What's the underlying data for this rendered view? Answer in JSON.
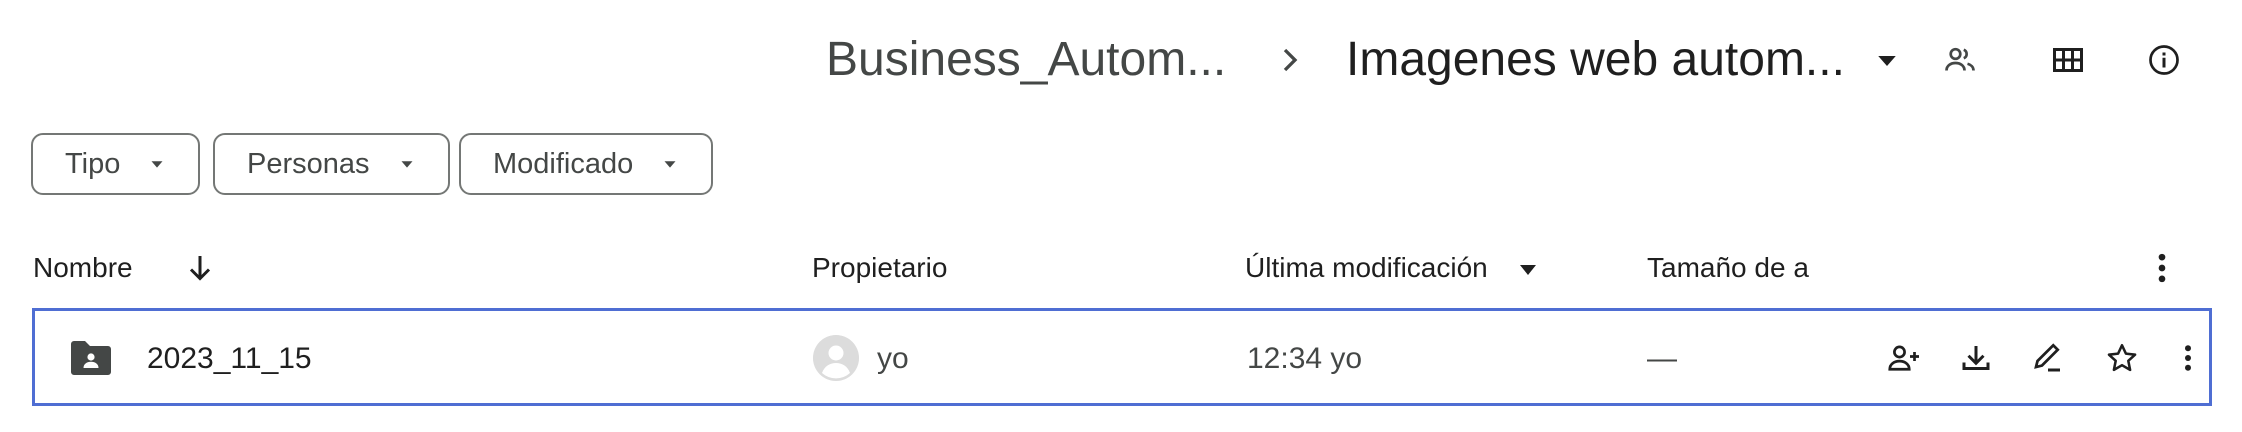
{
  "breadcrumb": {
    "parent": "Business_Autom...",
    "separator": "›",
    "current": "Imagenes web autom..."
  },
  "header_actions": [
    {
      "name": "manage-access-icon",
      "label": "Manage access"
    },
    {
      "name": "grid-view-icon",
      "label": "Grid view"
    },
    {
      "name": "info-icon",
      "label": "Details"
    }
  ],
  "filters": [
    {
      "label": "Tipo"
    },
    {
      "label": "Personas"
    },
    {
      "label": "Modificado"
    }
  ],
  "table": {
    "columns": {
      "name": "Nombre",
      "owner": "Propietario",
      "modified": "Última modificación",
      "size": "Tamaño de a"
    },
    "sort": {
      "column": "name",
      "direction": "descending"
    },
    "rows": [
      {
        "name": "2023_11_15",
        "type": "shared-folder",
        "owner": "yo",
        "modified": "12:34 yo",
        "size": "—",
        "actions": [
          "share-icon",
          "download-icon",
          "rename-icon",
          "star-icon",
          "more-icon"
        ]
      }
    ]
  },
  "colors": {
    "selection_border": "#4f6ed3",
    "icon": "#444746",
    "text": "#1f1f1f"
  }
}
